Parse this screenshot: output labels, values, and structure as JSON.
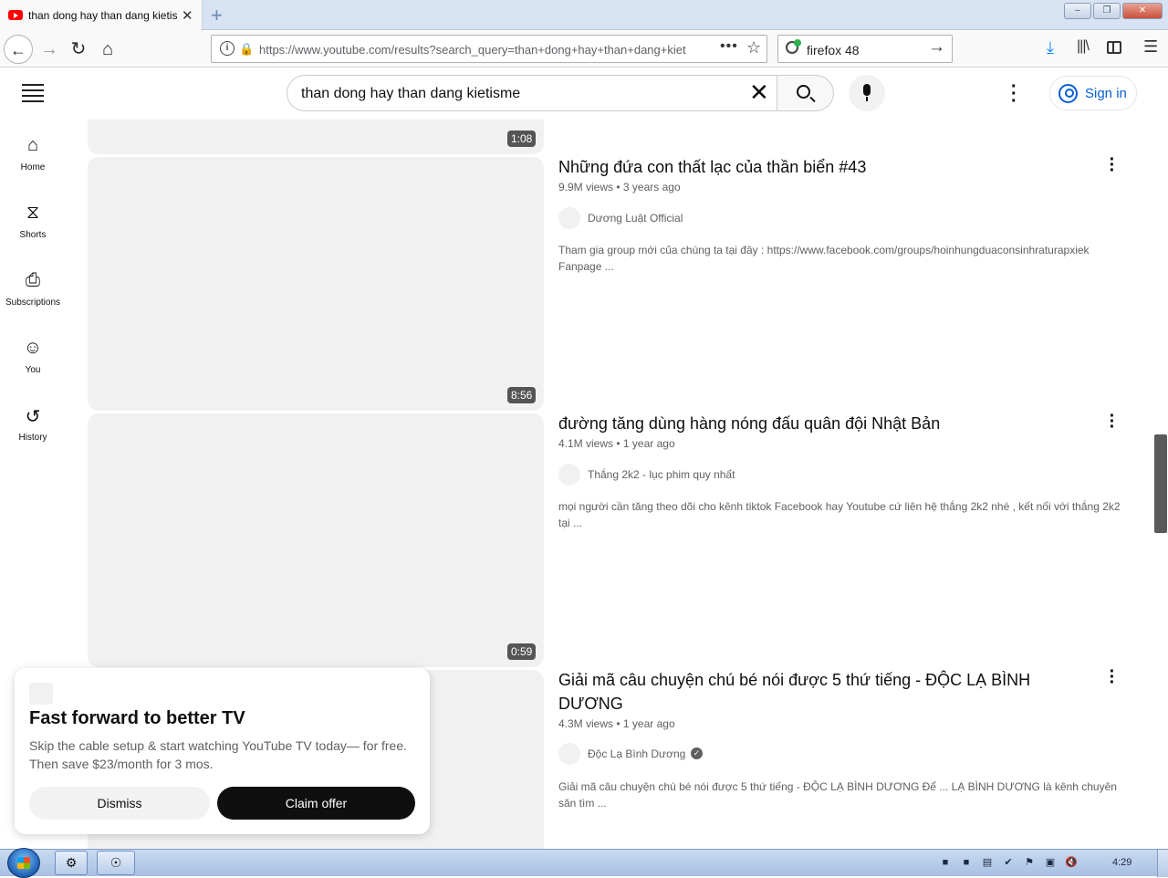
{
  "browser": {
    "tab_title": "than dong hay than dang kietisme - YouTube",
    "tab_close": "✕",
    "new_tab": "+",
    "url": "https://www.youtube.com/results?search_query=than+dong+hay+than+dang+kietisme",
    "search_value": "firefox 48",
    "window_controls": [
      "–",
      "❐",
      "✕"
    ]
  },
  "youtube": {
    "search_query": "than dong hay than dang kietisme",
    "sign_in_label": "Sign in",
    "guide": [
      {
        "label": "Home",
        "icon": "home-icon"
      },
      {
        "label": "Shorts",
        "icon": "shorts-icon"
      },
      {
        "label": "Subscriptions",
        "icon": "subscriptions-icon"
      },
      {
        "label": "You",
        "icon": "you-icon"
      },
      {
        "label": "History",
        "icon": "history-icon"
      }
    ],
    "results": [
      {
        "duration": "1:08"
      },
      {
        "title": "Những đứa con thất lạc của thần biển #43",
        "views": "9.9M views",
        "age": "3 years ago",
        "channel": "Dương Luật Official",
        "verified": false,
        "description": "Tham gia group mới của chúng ta tại đây : https://www.facebook.com/groups/hoinhungduaconsinhraturapxiek Fanpage ...",
        "duration": "8:56"
      },
      {
        "title": "đường tăng dùng hàng nóng đấu quân đội Nhật Bản",
        "views": "4.1M views",
        "age": "1 year ago",
        "channel": "Thắng 2k2 - lục phim quy nhất",
        "verified": false,
        "description": "mọi người cần tăng theo dõi cho kênh tiktok Facebook hay Youtube cứ liên hệ thắng 2k2 nhé , kết nối với thắng 2k2 tại ...",
        "duration": "0:59"
      },
      {
        "title": "Giải mã câu chuyện chú bé nói được 5 thứ tiếng - ĐỘC LẠ BÌNH DƯƠNG",
        "views": "4.3M views",
        "age": "1 year ago",
        "channel": "Độc Lạ Bình Dương",
        "verified": true,
        "description": "Giải mã câu chuyện chú bé nói được 5 thứ tiếng - ĐỘC LẠ BÌNH DƯƠNG Để ... LẠ BÌNH DƯƠNG là kênh chuyên săn tìm ..."
      }
    ],
    "promo": {
      "title": "Fast forward to better TV",
      "body": "Skip the cable setup & start watching YouTube TV today— for free. Then save $23/month for 3 mos.",
      "dismiss_label": "Dismiss",
      "claim_label": "Claim offer"
    }
  },
  "taskbar": {
    "clock": "4:29"
  },
  "colors": {
    "brand_red": "#ff0000",
    "link_blue": "#065fd4",
    "text_primary": "#0f0f0f",
    "text_secondary": "#606060"
  }
}
